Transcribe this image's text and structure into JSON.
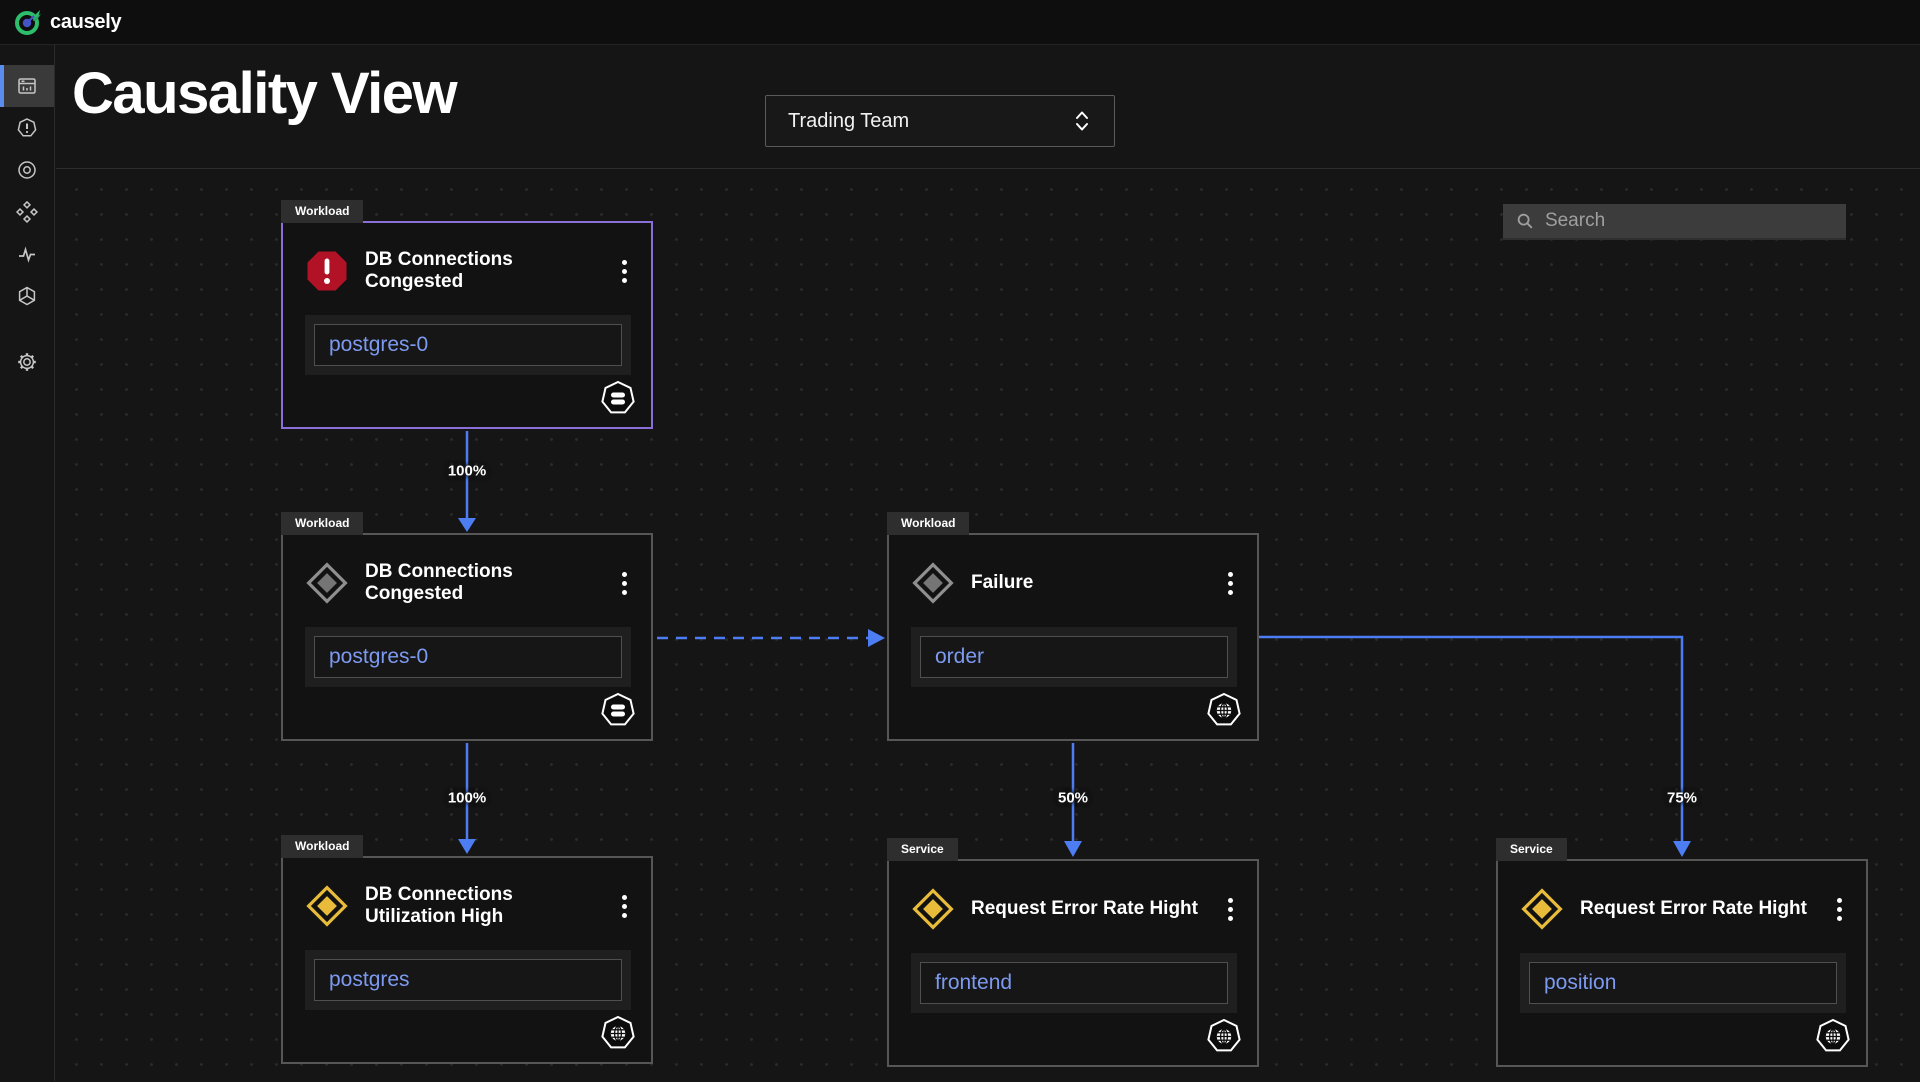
{
  "brand": {
    "name": "causely"
  },
  "page": {
    "title": "Causality View"
  },
  "team_selector": {
    "value": "Trading Team"
  },
  "search": {
    "placeholder": "Search"
  },
  "sidebar": {
    "items": [
      {
        "icon": "dashboard-icon",
        "active": true
      },
      {
        "icon": "alert-heptagon-icon",
        "active": false
      },
      {
        "icon": "target-icon",
        "active": false
      },
      {
        "icon": "diamond-cluster-icon",
        "active": false
      },
      {
        "icon": "pulse-icon",
        "active": false
      },
      {
        "icon": "hex-wheel-icon",
        "active": false
      },
      {
        "icon": "gear-icon",
        "active": false
      }
    ]
  },
  "nodes": [
    {
      "tag": "Workload",
      "severity_icon": "critical-octagon-alert",
      "title": "DB Connections Congested",
      "entity": "postgres-0",
      "badge_icon": "database-heptagon",
      "selected": true
    },
    {
      "tag": "Workload",
      "severity_icon": "diamond-gray",
      "title": "DB Connections Congested",
      "entity": "postgres-0",
      "badge_icon": "database-heptagon",
      "selected": false
    },
    {
      "tag": "Workload",
      "severity_icon": "diamond-yellow",
      "title": "DB Connections Utilization High",
      "entity": "postgres",
      "badge_icon": "globe-heptagon",
      "selected": false
    },
    {
      "tag": "Workload",
      "severity_icon": "diamond-gray",
      "title": "Failure",
      "entity": "order",
      "badge_icon": "globe-heptagon",
      "selected": false
    },
    {
      "tag": "Service",
      "severity_icon": "diamond-yellow",
      "title": "Request Error Rate Hight",
      "entity": "frontend",
      "badge_icon": "globe-heptagon",
      "selected": false
    },
    {
      "tag": "Service",
      "severity_icon": "diamond-yellow",
      "title": "Request Error Rate Hight",
      "entity": "position",
      "badge_icon": "globe-heptagon",
      "selected": false
    }
  ],
  "edges": [
    {
      "from": "DB Connections Congested (root)",
      "to": "DB Connections Congested",
      "label": "100%",
      "style": "solid"
    },
    {
      "from": "DB Connections Congested",
      "to": "DB Connections Utilization High",
      "label": "100%",
      "style": "solid"
    },
    {
      "from": "DB Connections Congested",
      "to": "Failure",
      "label": "",
      "style": "dashed"
    },
    {
      "from": "Failure",
      "to": "Request Error Rate Hight (frontend)",
      "label": "50%",
      "style": "solid"
    },
    {
      "from": "Failure",
      "to": "Request Error Rate Hight (position)",
      "label": "75%",
      "style": "solid"
    }
  ],
  "colors": {
    "edge_blue": "#4d7df2",
    "entity_link": "#7d9af0",
    "selected_border": "#8b6fd8",
    "warning_yellow": "#e8bb3a",
    "critical_red": "#b11226",
    "brand_green": "#2ebd6b",
    "node_bg": "#121212",
    "canvas_bg": "#151515"
  }
}
